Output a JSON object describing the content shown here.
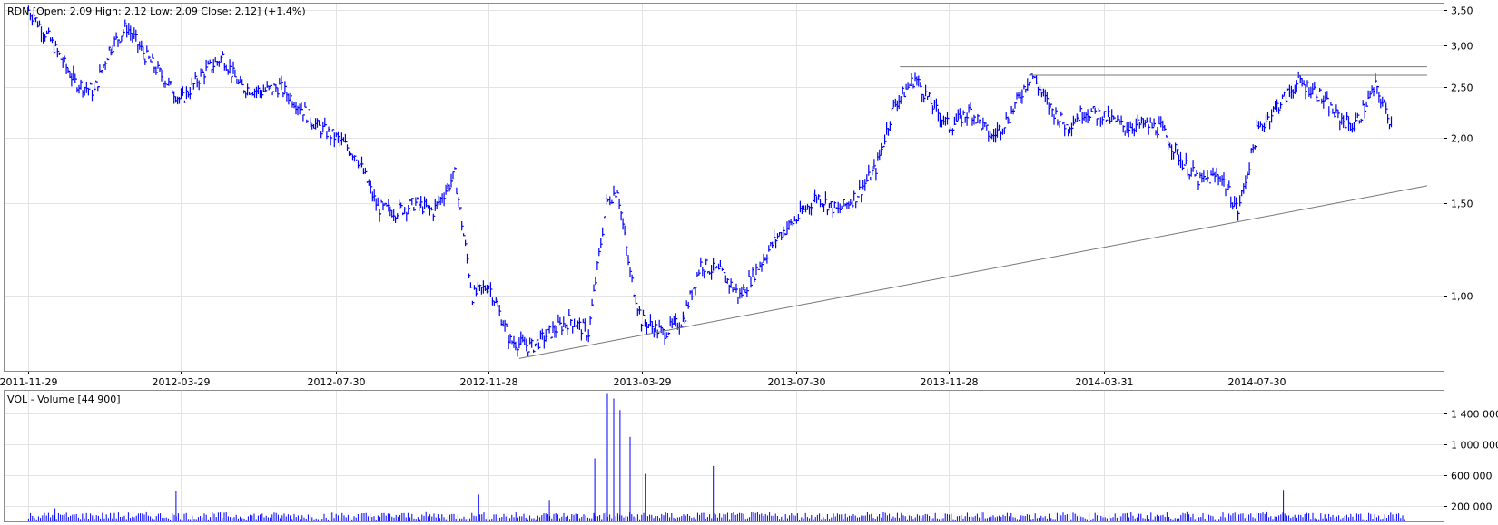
{
  "price_panel": {
    "header": "RDN [Open: 2,09  High: 2,12  Low: 2,09  Close: 2,12] (+1,4%)",
    "y_ticks": [
      "1,00",
      "1,50",
      "2,00",
      "2,50",
      "3,00",
      "3,50"
    ],
    "x_ticks": [
      "2011-11-29",
      "2012-03-29",
      "2012-07-30",
      "2012-11-28",
      "2013-03-29",
      "2013-07-30",
      "2013-11-28",
      "2014-03-31",
      "2014-07-30"
    ]
  },
  "volume_panel": {
    "header": "VOL - Volume [44 900]",
    "y_ticks": [
      "200 000",
      "600 000",
      "1 000 000",
      "1 400 000"
    ]
  },
  "colors": {
    "series": "#0000ff",
    "trendline": "#777777",
    "grid": "#e4e4e4",
    "frame": "#8c8c8c"
  },
  "chart_data": [
    {
      "type": "line",
      "title": "RDN [Open: 2,09  High: 2,12  Low: 2,09  Close: 2,12] (+1,4%)",
      "y_scale": "log",
      "ylim": [
        0.72,
        3.6
      ],
      "x": [
        "2011-11-29",
        "2011-12-15",
        "2012-01-05",
        "2012-01-20",
        "2012-02-01",
        "2012-02-15",
        "2012-02-28",
        "2012-03-15",
        "2012-03-29",
        "2012-04-15",
        "2012-05-01",
        "2012-05-15",
        "2012-06-01",
        "2012-06-15",
        "2012-07-01",
        "2012-07-15",
        "2012-07-30",
        "2012-08-15",
        "2012-09-01",
        "2012-09-15",
        "2012-10-01",
        "2012-10-15",
        "2012-11-01",
        "2012-11-15",
        "2012-11-28",
        "2012-12-15",
        "2013-01-01",
        "2013-01-15",
        "2013-02-01",
        "2013-02-15",
        "2013-03-01",
        "2013-03-10",
        "2013-03-20",
        "2013-03-29",
        "2013-04-15",
        "2013-05-01",
        "2013-05-15",
        "2013-06-01",
        "2013-06-15",
        "2013-07-01",
        "2013-07-15",
        "2013-07-30",
        "2013-08-15",
        "2013-09-01",
        "2013-09-15",
        "2013-10-01",
        "2013-10-15",
        "2013-11-01",
        "2013-11-15",
        "2013-11-28",
        "2013-12-15",
        "2014-01-01",
        "2014-01-15",
        "2014-02-01",
        "2014-02-15",
        "2014-03-01",
        "2014-03-15",
        "2014-03-31",
        "2014-04-15",
        "2014-05-01",
        "2014-05-15",
        "2014-06-01",
        "2014-06-15",
        "2014-07-01",
        "2014-07-15",
        "2014-07-30",
        "2014-08-15",
        "2014-09-01",
        "2014-09-15",
        "2014-10-01",
        "2014-10-15",
        "2014-11-01",
        "2014-11-15"
      ],
      "series": [
        {
          "values": [
            3.5,
            3.1,
            2.55,
            2.45,
            2.95,
            3.25,
            2.9,
            2.6,
            2.35,
            2.65,
            2.85,
            2.5,
            2.45,
            2.5,
            2.3,
            2.1,
            2.0,
            1.85,
            1.47,
            1.45,
            1.5,
            1.45,
            1.7,
            1.0,
            1.05,
            0.82,
            0.8,
            0.85,
            0.9,
            0.85,
            1.5,
            1.6,
            1.1,
            0.9,
            0.85,
            0.9,
            1.15,
            1.1,
            1.0,
            1.15,
            1.3,
            1.4,
            1.55,
            1.45,
            1.55,
            1.75,
            2.3,
            2.6,
            2.3,
            2.1,
            2.25,
            2.0,
            2.2,
            2.65,
            2.3,
            2.1,
            2.25,
            2.2,
            2.1,
            2.12,
            2.08,
            1.8,
            1.65,
            1.7,
            1.45,
            2.05,
            2.3,
            2.55,
            2.45,
            2.2,
            2.1,
            2.5,
            2.1
          ]
        }
      ],
      "trendlines": [
        {
          "from": [
            "2012-12-22",
            0.76
          ],
          "to": [
            "2014-12-12",
            1.62
          ]
        },
        {
          "from": [
            "2013-10-20",
            2.73
          ],
          "to": [
            "2014-12-12",
            2.73
          ]
        },
        {
          "from": [
            "2014-01-30",
            2.63
          ],
          "to": [
            "2014-12-12",
            2.63
          ]
        }
      ]
    },
    {
      "type": "bar",
      "title": "VOL - Volume [44 900]",
      "ylim": [
        0,
        1700000
      ],
      "x": [
        "2011-12-20",
        "2012-03-25",
        "2012-11-20",
        "2013-01-15",
        "2013-02-20",
        "2013-03-02",
        "2013-03-07",
        "2013-03-12",
        "2013-03-20",
        "2013-04-01",
        "2013-05-25",
        "2013-08-20",
        "2014-08-20"
      ],
      "values": [
        170000,
        400000,
        350000,
        280000,
        820000,
        1670000,
        1600000,
        1450000,
        1100000,
        620000,
        720000,
        780000,
        410000
      ],
      "typical_volume": 80000
    }
  ]
}
